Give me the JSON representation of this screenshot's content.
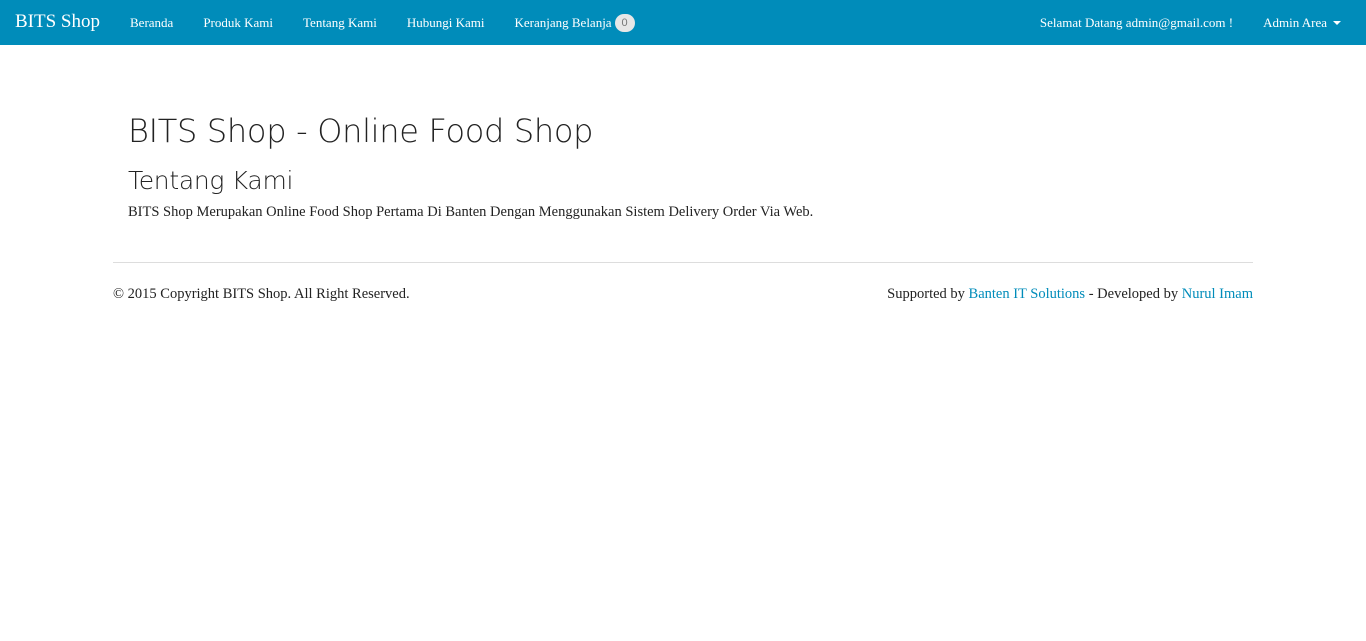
{
  "navbar": {
    "brand": "BITS Shop",
    "items": [
      {
        "label": "Beranda"
      },
      {
        "label": "Produk Kami"
      },
      {
        "label": "Tentang Kami"
      },
      {
        "label": "Hubungi Kami"
      },
      {
        "label": "Keranjang Belanja"
      }
    ],
    "cart_count": "0",
    "welcome": "Selamat Datang admin@gmail.com !",
    "admin_label": "Admin Area",
    "admin_icon": "caret-down-icon",
    "bg_color": "#008cba"
  },
  "main": {
    "title": "BITS Shop - Online Food Shop",
    "subtitle": "Tentang Kami",
    "description": "BITS Shop Merupakan Online Food Shop Pertama Di Banten Dengan Menggunakan Sistem Delivery Order Via Web."
  },
  "footer": {
    "copyright": "© 2015 Copyright BITS Shop. All Right Reserved.",
    "supported_prefix": "Supported by ",
    "supported_link": "Banten IT Solutions",
    "developed_prefix": " - Developed by ",
    "developed_link": "Nurul Imam",
    "link_color": "#008cba"
  }
}
